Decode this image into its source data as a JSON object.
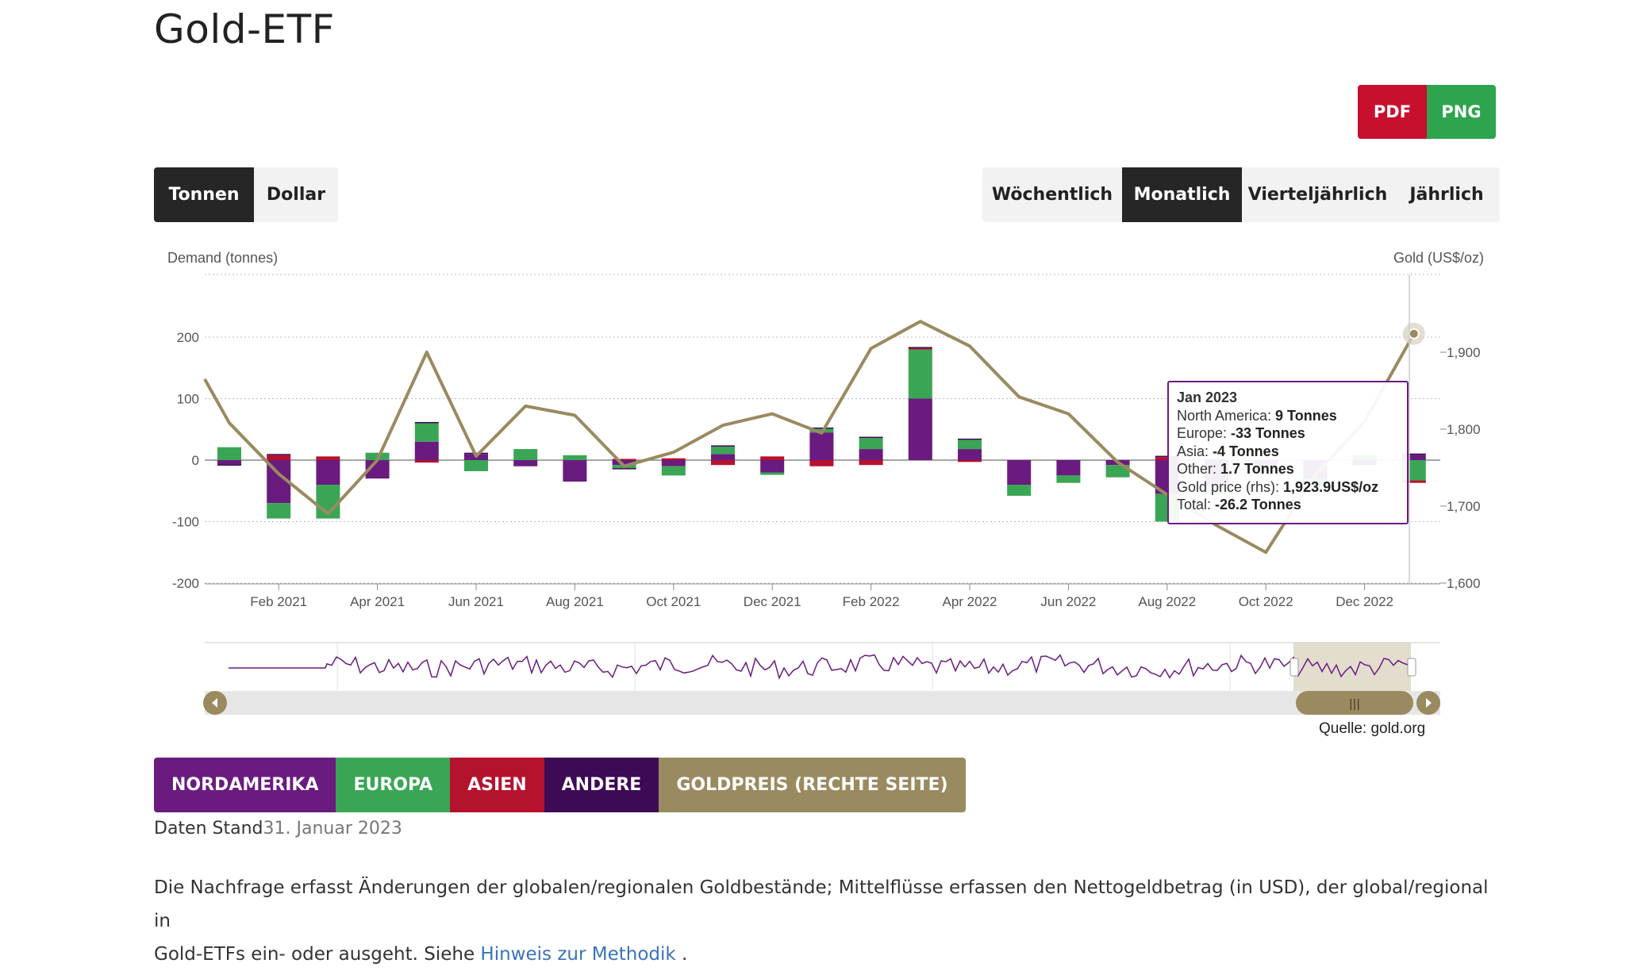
{
  "page": {
    "title": "Gold-ETF",
    "export": {
      "pdf": "PDF",
      "png": "PNG"
    },
    "unit_toggle": [
      "Tonnen",
      "Dollar"
    ],
    "unit_active": "Tonnen",
    "period_toggle": [
      "Wöchentlich",
      "Monatlich",
      "Vierteljährlich",
      "Jährlich"
    ],
    "period_active": "Monatlich",
    "legend": [
      {
        "label": "NORDAMERIKA",
        "color": "#6a1b7f"
      },
      {
        "label": "EUROPA",
        "color": "#3aa655"
      },
      {
        "label": "ASIEN",
        "color": "#b5122e"
      },
      {
        "label": "ANDERE",
        "color": "#3d0a55"
      },
      {
        "label": "GOLDPREIS (RECHTE SEITE)",
        "color": "#9a8a60"
      }
    ],
    "source": "Quelle: gold.org",
    "stand_label": "Daten Stand",
    "stand_date": "31. Januar 2023",
    "description_1": "Die Nachfrage erfasst Änderungen der globalen/regionalen Goldbestände; Mittelflüsse erfassen den Nettogeldbetrag (in USD), der global/regional in",
    "description_2": "Gold-ETFs ein- oder ausgeht. Siehe ",
    "description_link": "Hinweis zur Methodik",
    "description_end": " ."
  },
  "tooltip": {
    "title": "Jan 2023",
    "rows": [
      {
        "label": "North America: ",
        "value": "9 Tonnes"
      },
      {
        "label": "Europe: ",
        "value": "-33 Tonnes"
      },
      {
        "label": "Asia: ",
        "value": "-4 Tonnes"
      },
      {
        "label": "Other: ",
        "value": "1.7 Tonnes"
      },
      {
        "label": "Gold price (rhs): ",
        "value": "1,923.9US$/oz"
      },
      {
        "label": "Total: ",
        "value": "-26.2 Tonnes"
      }
    ]
  },
  "chart_data": {
    "type": "bar",
    "stacked": true,
    "ylabel": "Demand (tonnes)",
    "ylabel_right": "Gold (US$/oz)",
    "ylim": [
      -200,
      200
    ],
    "ylim_right": [
      1600,
      2000
    ],
    "yticks": [
      -200,
      -100,
      0,
      100,
      200
    ],
    "yticks_right": [
      1600,
      1700,
      1800,
      1900
    ],
    "ytick_labels_right": [
      "1,600",
      "1,700",
      "1,800",
      "1,900"
    ],
    "categories": [
      "Jan 2021",
      "Feb 2021",
      "Mar 2021",
      "Apr 2021",
      "May 2021",
      "Jun 2021",
      "Jul 2021",
      "Aug 2021",
      "Sep 2021",
      "Oct 2021",
      "Nov 2021",
      "Dec 2021",
      "Jan 2022",
      "Feb 2022",
      "Mar 2022",
      "Apr 2022",
      "May 2022",
      "Jun 2022",
      "Jul 2022",
      "Aug 2022",
      "Sep 2022",
      "Oct 2022",
      "Nov 2022",
      "Dec 2022",
      "Jan 2023"
    ],
    "xtick_labels": [
      "Feb 2021",
      "Apr 2021",
      "Jun 2021",
      "Aug 2021",
      "Oct 2021",
      "Dec 2021",
      "Feb 2022",
      "Apr 2022",
      "Jun 2022",
      "Aug 2022",
      "Oct 2022",
      "Dec 2022"
    ],
    "series": [
      {
        "name": "North America",
        "color": "#6a1b7f",
        "values": [
          -7,
          -70,
          -40,
          -30,
          30,
          10,
          -10,
          -35,
          -8,
          -10,
          10,
          -20,
          45,
          18,
          100,
          18,
          -40,
          -25,
          -8,
          -55,
          -40,
          -10,
          -30,
          -8,
          9
        ]
      },
      {
        "name": "Europe",
        "color": "#3aa655",
        "values": [
          21,
          -25,
          -55,
          12,
          30,
          -18,
          18,
          8,
          -5,
          -15,
          12,
          -4,
          6,
          18,
          80,
          15,
          -18,
          -12,
          -20,
          -45,
          -15,
          -10,
          -8,
          8,
          -33
        ]
      },
      {
        "name": "Asia",
        "color": "#b5122e",
        "values": [
          0,
          8,
          6,
          0,
          -4,
          0,
          0,
          0,
          2,
          3,
          -8,
          6,
          -10,
          -8,
          2,
          -3,
          0,
          0,
          0,
          5,
          2,
          0,
          0,
          0,
          -4
        ]
      },
      {
        "name": "Other",
        "color": "#3d0a55",
        "values": [
          -2,
          2,
          0,
          0,
          2,
          2,
          0,
          0,
          -2,
          0,
          2,
          0,
          2,
          2,
          2,
          2,
          0,
          0,
          0,
          2,
          0,
          0,
          0,
          0,
          1.7
        ]
      }
    ],
    "line": {
      "name": "Gold price (rhs)",
      "color": "#9a8a60",
      "axis": "right",
      "values": [
        1865,
        1808,
        1742,
        1690,
        1760,
        1900,
        1765,
        1830,
        1818,
        1752,
        1770,
        1805,
        1820,
        1795,
        1905,
        1940,
        1908,
        1842,
        1820,
        1757,
        1715,
        1675,
        1640,
        1740,
        1810,
        1924
      ]
    }
  }
}
